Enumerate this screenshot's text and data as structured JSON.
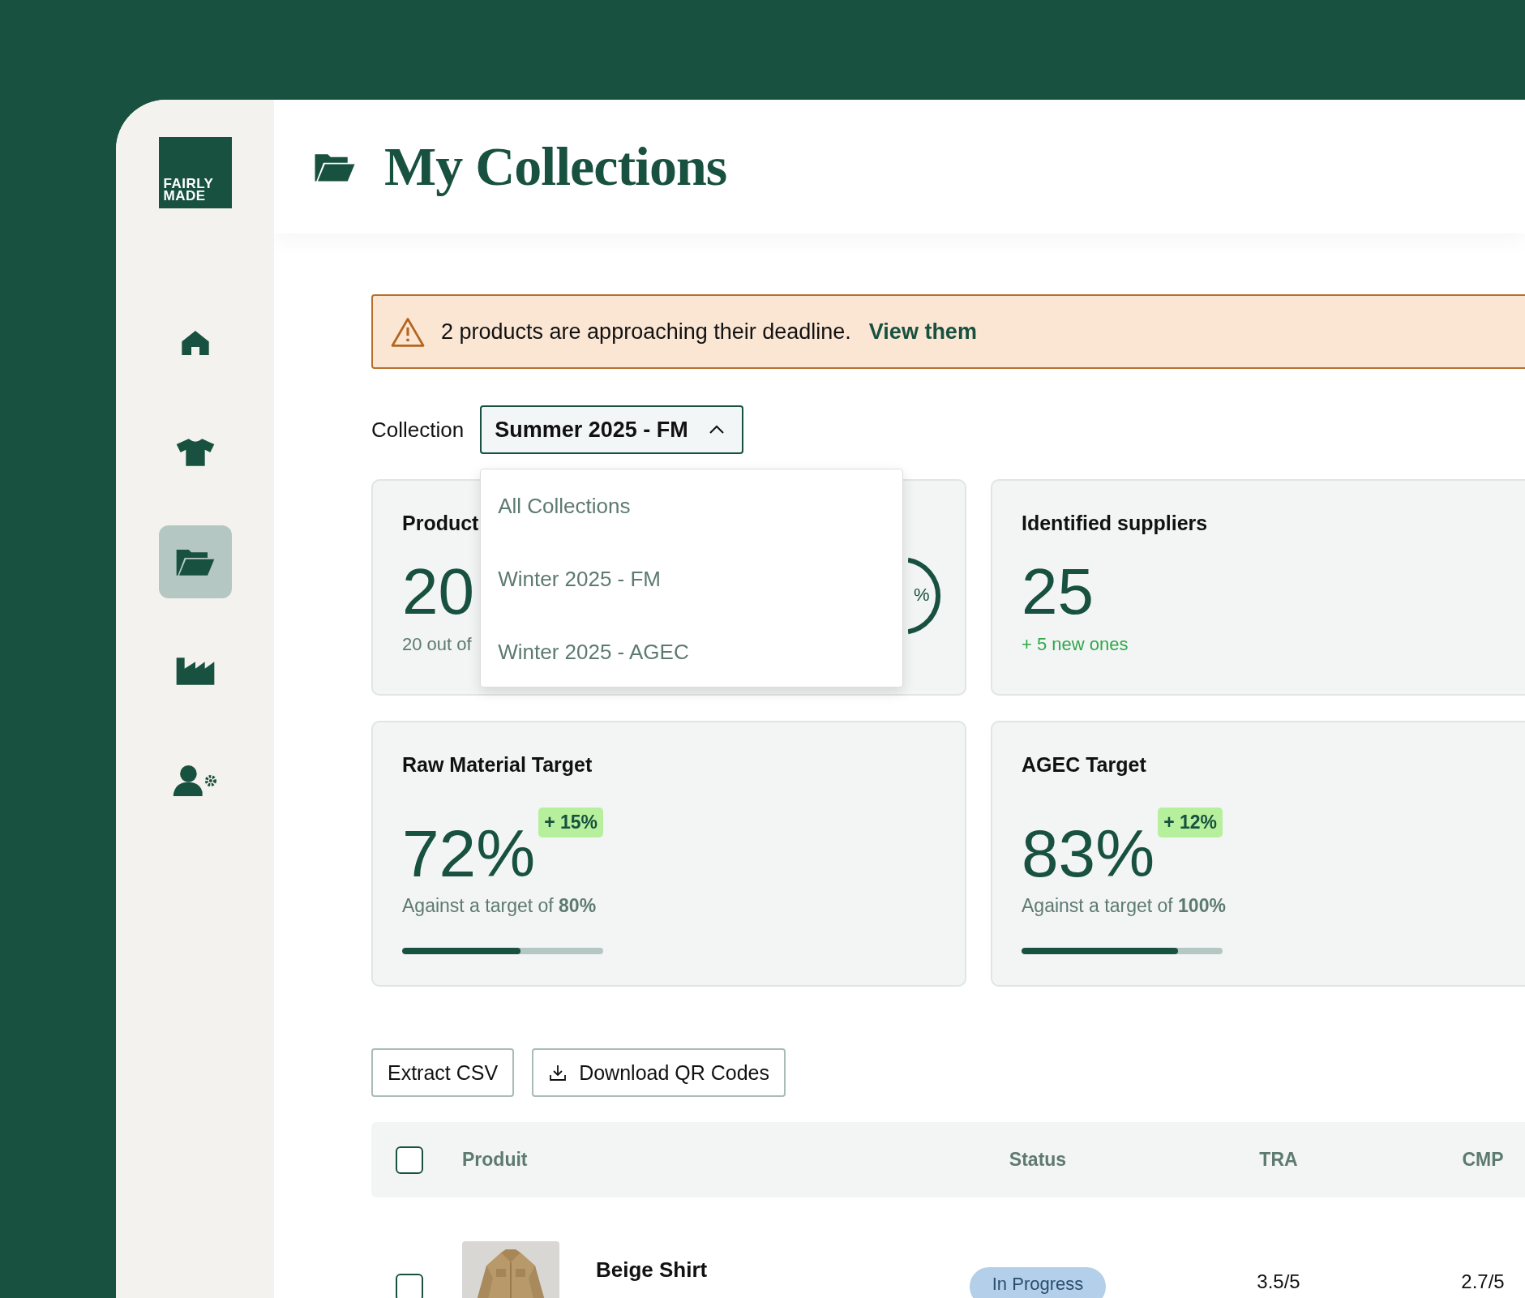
{
  "sidebar": {
    "logo": [
      "FAIRLY",
      "MADE"
    ],
    "items": [
      {
        "kind": "home",
        "selected": false
      },
      {
        "kind": "shirt",
        "selected": false
      },
      {
        "kind": "folder",
        "selected": true
      },
      {
        "kind": "factory",
        "selected": false
      },
      {
        "kind": "user-settings",
        "selected": false
      }
    ]
  },
  "header": {
    "title": "My Collections"
  },
  "alert": {
    "message": "2 products are approaching their deadline.",
    "link": "View them"
  },
  "collection": {
    "label": "Collection",
    "value": "Summer 2025 - FM",
    "expanded": true,
    "options": [
      "All Collections",
      "Winter 2025 - FM",
      "Winter 2025 - AGEC"
    ]
  },
  "stat_cards": [
    {
      "title": "Product",
      "value": "20",
      "subtitle": "20 out of",
      "ring_label": "%"
    },
    {
      "title": "Identified suppliers",
      "value": "25",
      "subtitle": "+ 5 new ones"
    }
  ],
  "target_cards": [
    {
      "title": "Raw Material Target",
      "value": "72%",
      "change": "+ 15%",
      "caption": "Against a target of **80%**",
      "level": 0.59
    },
    {
      "title": "AGEC Target",
      "value": "83%",
      "change": "+ 12%",
      "caption": "Against a target of **100%**",
      "level": 0.78
    }
  ],
  "actions": [
    {
      "label": "Extract CSV",
      "kind": "plain"
    },
    {
      "label": "Download QR Codes",
      "kind": "download"
    }
  ],
  "table": {
    "select_all": {
      "checked": false
    },
    "columns": [
      "Produit",
      "Status",
      "TRA",
      "CMP"
    ],
    "rows": [
      {
        "checked": false,
        "name": "Beige Shirt",
        "status": "In Progress",
        "tra": "3.5/5",
        "cmp": "2.7/5"
      }
    ]
  }
}
